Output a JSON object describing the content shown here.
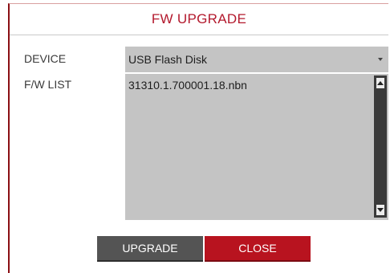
{
  "dialog": {
    "title": "FW UPGRADE"
  },
  "device": {
    "label": "DEVICE",
    "selected": "USB Flash Disk"
  },
  "fw_list": {
    "label": "F/W LIST",
    "items": [
      "31310.1.700001.18.nbn"
    ]
  },
  "buttons": {
    "upgrade": "UPGRADE",
    "close": "CLOSE"
  },
  "colors": {
    "title": "#b3192d",
    "close_button": "#b8131f",
    "upgrade_button": "#545454",
    "field_background": "#c4c4c4",
    "dialog_border": "#8a0f14"
  },
  "icons": {
    "device_dropdown": "chevron-down-icon",
    "scroll_up": "arrow-up-icon",
    "scroll_down": "arrow-down-icon"
  }
}
